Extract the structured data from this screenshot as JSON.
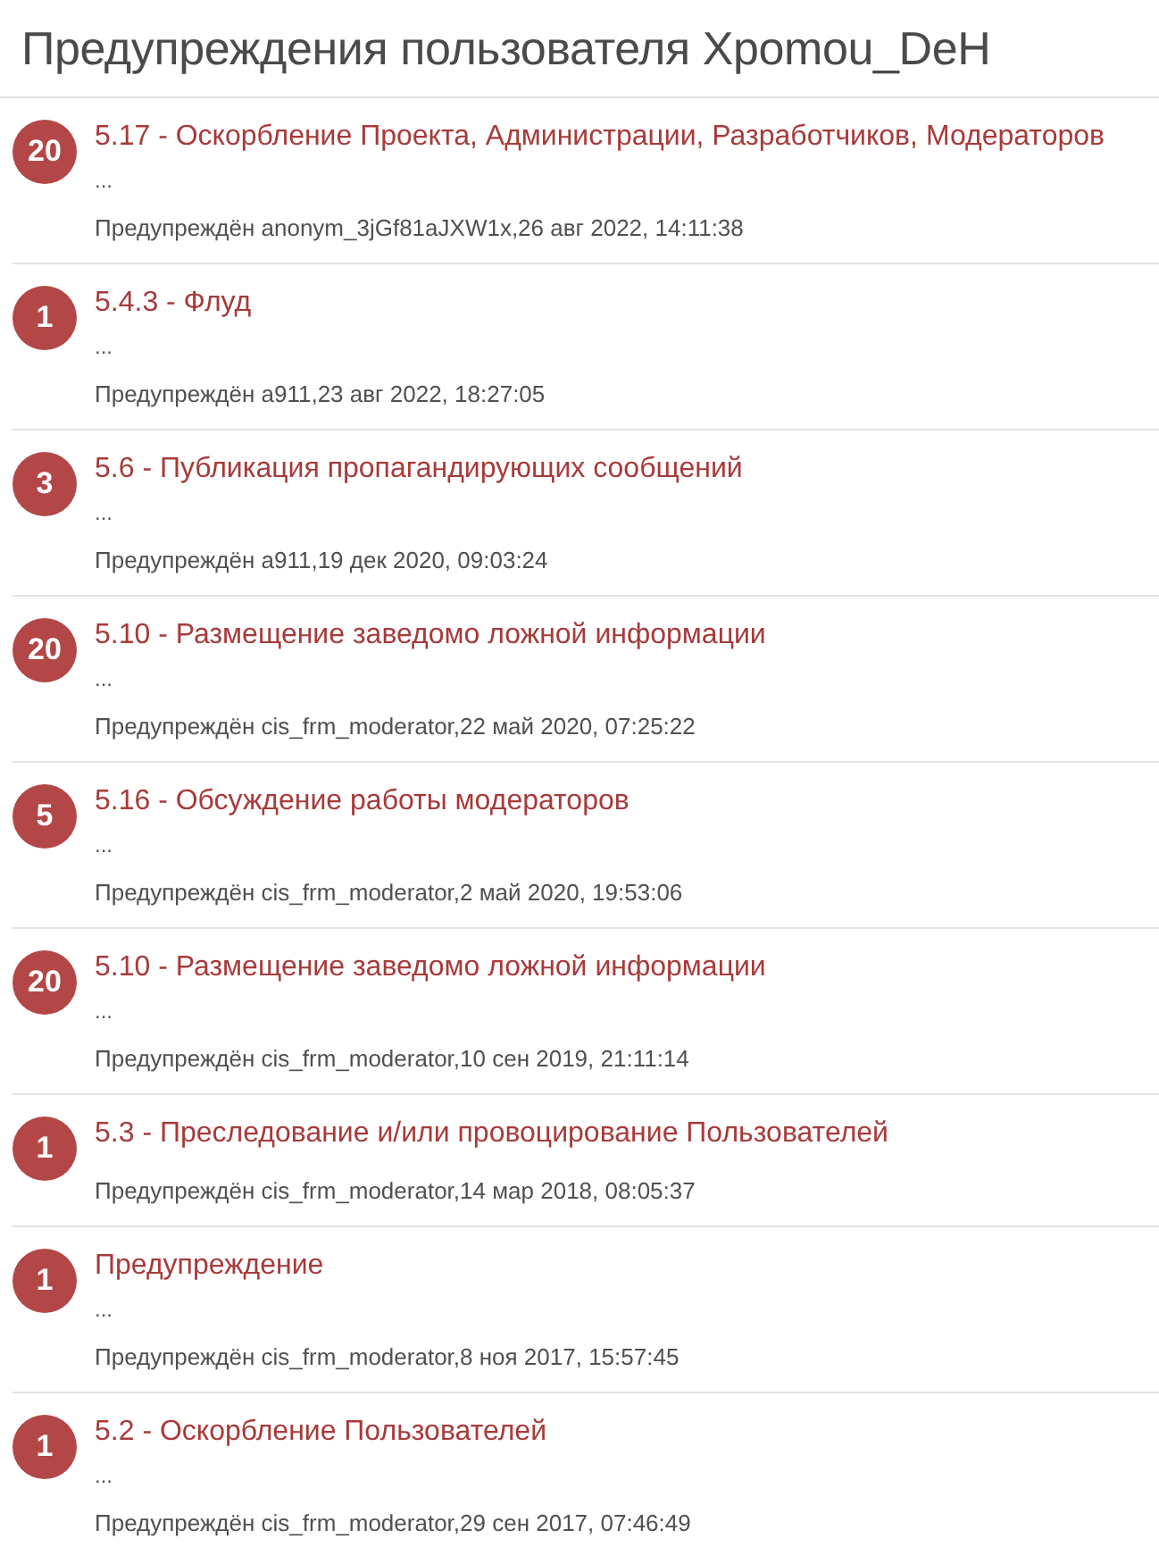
{
  "title": "Предупреждения пользователя Xpomou_DeH",
  "warnings": [
    {
      "points": "20",
      "reason": "5.17 - Оскорбление Проекта, Администрации, Разработчиков, Модераторов",
      "excerpt": "...",
      "meta": "Предупреждён anonym_3jGf81aJXW1x,26 авг 2022, 14:11:38"
    },
    {
      "points": "1",
      "reason": "5.4.3 - Флуд",
      "excerpt": "...",
      "meta": "Предупреждён a911,23 авг 2022, 18:27:05"
    },
    {
      "points": "3",
      "reason": "5.6 - Публикация пропагандирующих сообщений",
      "excerpt": "...",
      "meta": "Предупреждён a911,19 дек 2020, 09:03:24"
    },
    {
      "points": "20",
      "reason": "5.10 - Размещение заведомо ложной информации",
      "excerpt": "...",
      "meta": "Предупреждён cis_frm_moderator,22 май 2020, 07:25:22"
    },
    {
      "points": "5",
      "reason": "5.16 - Обсуждение работы модераторов",
      "excerpt": "...",
      "meta": "Предупреждён cis_frm_moderator,2 май 2020, 19:53:06"
    },
    {
      "points": "20",
      "reason": "5.10 - Размещение заведомо ложной информации",
      "excerpt": "...",
      "meta": "Предупреждён cis_frm_moderator,10 сен 2019, 21:11:14"
    },
    {
      "points": "1",
      "reason": "5.3 - Преследование и/или провоцирование Пользователей",
      "meta": "Предупреждён cis_frm_moderator,14 мар 2018, 08:05:37"
    },
    {
      "points": "1",
      "reason": "Предупреждение",
      "excerpt": "...",
      "meta": "Предупреждён cis_frm_moderator,8 ноя 2017, 15:57:45"
    },
    {
      "points": "1",
      "reason": "5.2 - Оскорбление Пользователей",
      "excerpt": "...",
      "meta": "Предупреждён cis_frm_moderator,29 сен 2017, 07:46:49"
    }
  ]
}
